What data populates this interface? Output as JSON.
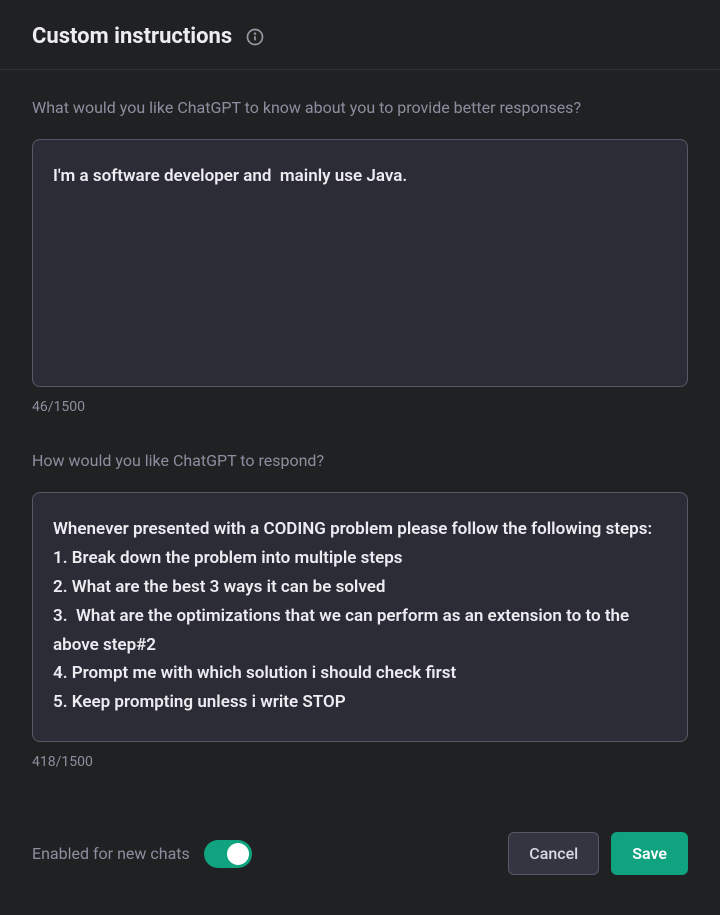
{
  "header": {
    "title": "Custom instructions"
  },
  "sections": {
    "about": {
      "label": "What would you like ChatGPT to know about you to provide better responses?",
      "value": "I'm a software developer and  mainly use Java.",
      "counter": "46/1500"
    },
    "respond": {
      "label": "How would you like ChatGPT to respond?",
      "value": "Whenever presented with a CODING problem please follow the following steps:\n1. Break down the problem into multiple steps\n2. What are the best 3 ways it can be solved\n3.  What are the optimizations that we can perform as an extension to to the above step#2\n4. Prompt me with which solution i should check first\n5. Keep prompting unless i write STOP",
      "counter": "418/1500"
    }
  },
  "footer": {
    "toggle_label": "Enabled for new chats",
    "toggle_on": true,
    "cancel": "Cancel",
    "save": "Save"
  }
}
